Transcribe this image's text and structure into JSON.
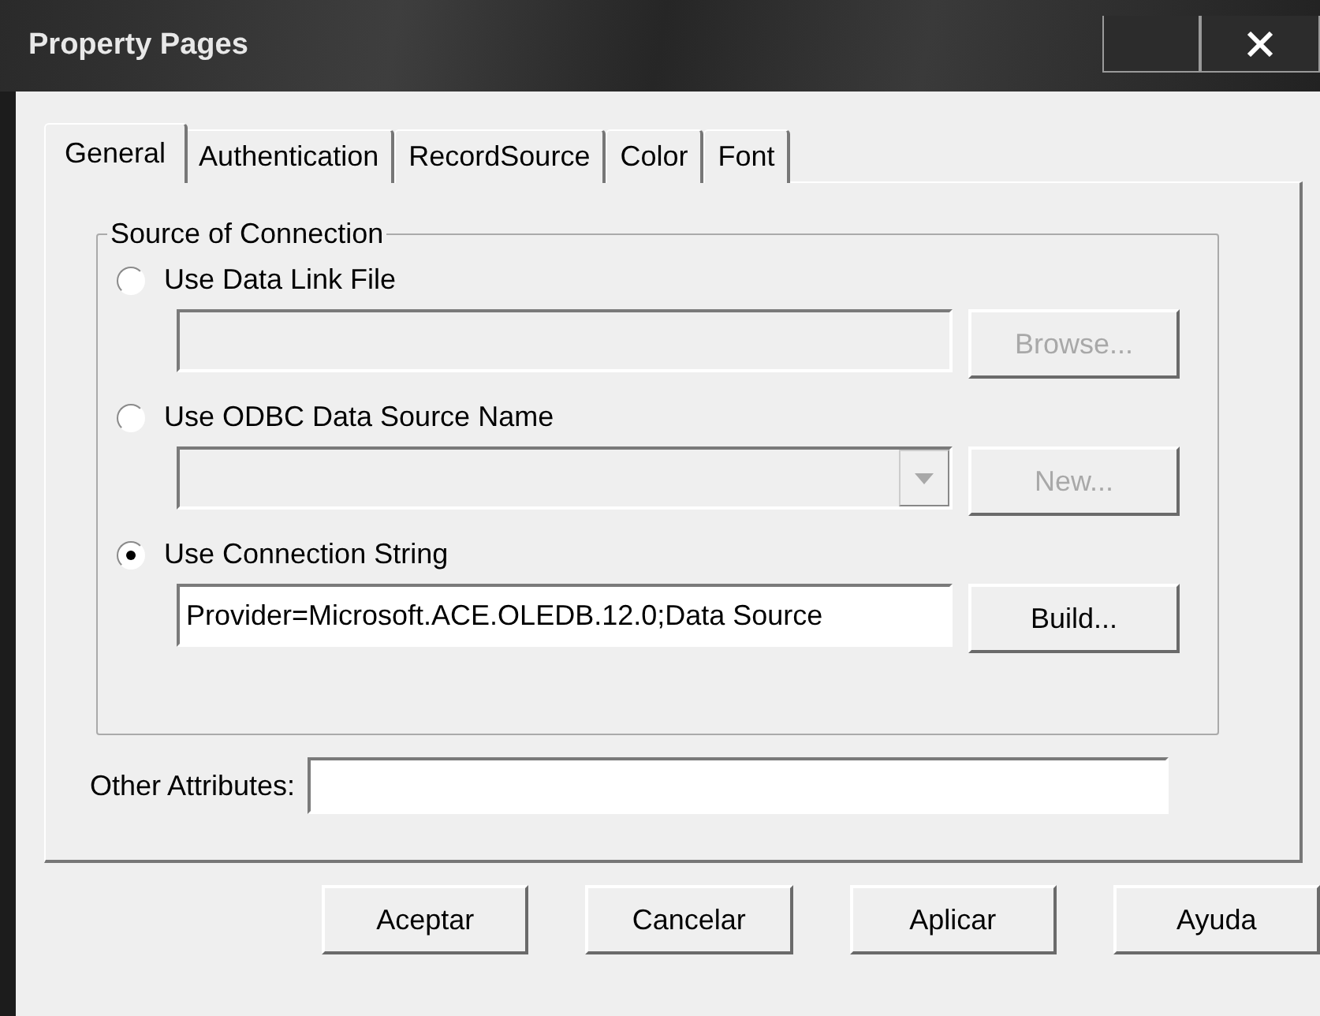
{
  "window": {
    "title": "Property Pages"
  },
  "tabs": [
    {
      "label": "General",
      "selected": true
    },
    {
      "label": "Authentication",
      "selected": false
    },
    {
      "label": "RecordSource",
      "selected": false
    },
    {
      "label": "Color",
      "selected": false
    },
    {
      "label": "Font",
      "selected": false
    }
  ],
  "group": {
    "title": "Source of Connection"
  },
  "options": [
    {
      "label": "Use Data Link File",
      "selected": false,
      "field": {
        "kind": "text",
        "disabled": true
      },
      "button": {
        "label": "Browse...",
        "disabled": true
      }
    },
    {
      "label": "Use ODBC Data Source Name",
      "selected": false,
      "field": {
        "kind": "combo",
        "disabled": true
      },
      "button": {
        "label": "New...",
        "disabled": true
      }
    },
    {
      "label": "Use Connection String",
      "selected": true,
      "field": {
        "kind": "text",
        "value": "Provider=Microsoft.ACE.OLEDB.12.0;Data Source",
        "disabled": false
      },
      "button": {
        "label": "Build...",
        "disabled": false
      }
    }
  ],
  "other_attributes": {
    "label": "Other Attributes:"
  },
  "buttons": [
    "Aceptar",
    "Cancelar",
    "Aplicar",
    "Ayuda"
  ]
}
